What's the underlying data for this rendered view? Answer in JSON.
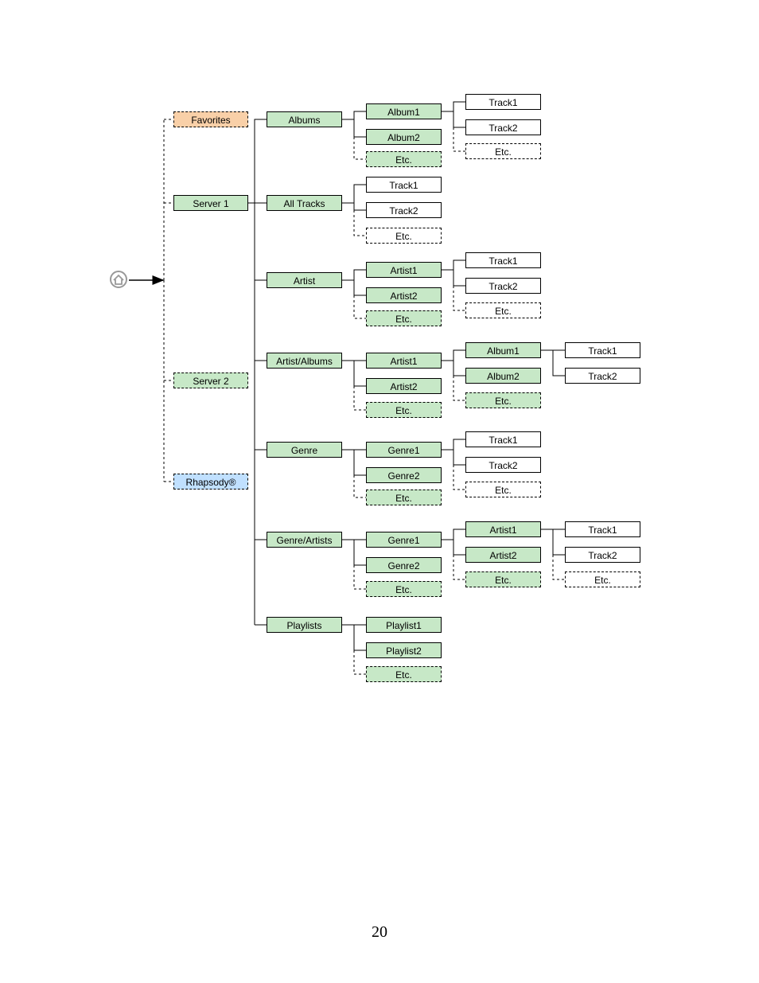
{
  "page_number": "20",
  "colors": {
    "green": "#c7e8c7",
    "orange": "#f9d0a8",
    "blue": "#c0e0ff",
    "white": "#ffffff"
  },
  "root_icon": "home-icon",
  "level1": {
    "favorites": "Favorites",
    "server1": "Server 1",
    "server2": "Server 2",
    "rhapsody": "Rhapsody®"
  },
  "level2": {
    "albums": "Albums",
    "all_tracks": "All Tracks",
    "artist": "Artist",
    "artist_albums": "Artist/Albums",
    "genre": "Genre",
    "genre_artists": "Genre/Artists",
    "playlists": "Playlists"
  },
  "level3": {
    "album1": "Album1",
    "album2": "Album2",
    "track1": "Track1",
    "track2": "Track2",
    "artist1": "Artist1",
    "artist2": "Artist2",
    "genre1": "Genre1",
    "genre2": "Genre2",
    "playlist1": "Playlist1",
    "playlist2": "Playlist2",
    "etc": "Etc."
  },
  "level4": {
    "track1": "Track1",
    "track2": "Track2",
    "album1": "Album1",
    "album2": "Album2",
    "artist1": "Artist1",
    "artist2": "Artist2",
    "etc": "Etc."
  },
  "level5": {
    "track1": "Track1",
    "track2": "Track2",
    "etc": "Etc."
  }
}
